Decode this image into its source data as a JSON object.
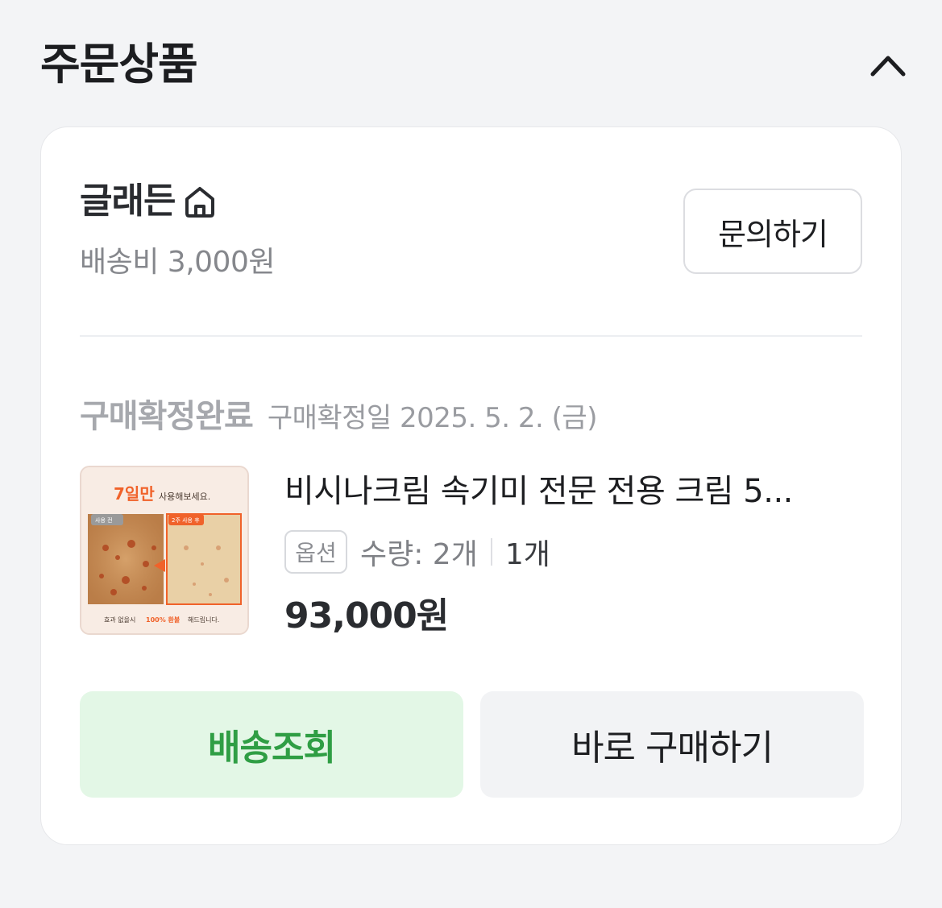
{
  "section": {
    "title": "주문상품",
    "collapse_icon": "chevron-up-icon"
  },
  "seller": {
    "name": "글래든",
    "icon": "home-icon",
    "shipping_fee": "배송비 3,000원",
    "inquiry_label": "문의하기"
  },
  "order": {
    "status": "구매확정완료",
    "confirm_date": "구매확정일 2025. 5. 2. (금)"
  },
  "product": {
    "thumbnail": {
      "headline_accent": "7일만",
      "headline_rest": "사용해보세요.",
      "before_label": "사용 전",
      "after_label": "2주 사용 후",
      "footer_pre": "효과 없을시",
      "footer_accent": "100% 환불",
      "footer_post": "해드립니다."
    },
    "name": "비시나크림 속기미 전문 전용 크림 5...",
    "option_badge": "옵션",
    "quantity_label": "수량: 2개",
    "quantity_count": "1개",
    "price": "93,000원"
  },
  "actions": {
    "track_label": "배송조회",
    "buy_again_label": "바로 구매하기"
  },
  "colors": {
    "background": "#f3f4f6",
    "card": "#ffffff",
    "track_bg": "#e3f7e6",
    "track_text": "#2f9e44",
    "buy_bg": "#f2f3f5",
    "thumb_accent": "#f0622a"
  }
}
